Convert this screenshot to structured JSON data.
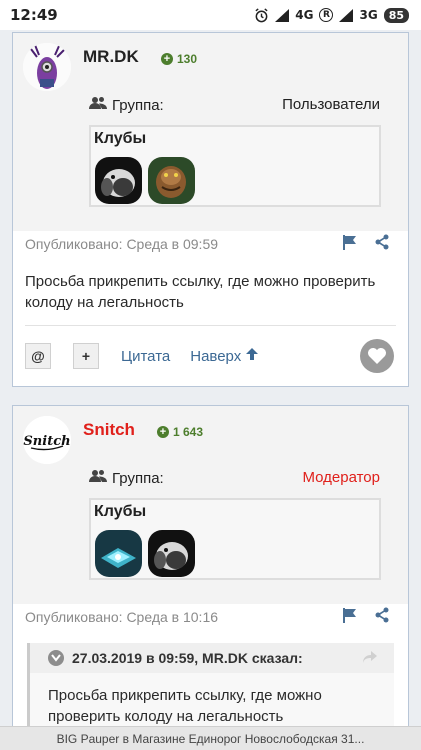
{
  "status_bar": {
    "time": "12:49",
    "network_1": "4G",
    "network_2": "3G",
    "registered_mark": "R",
    "battery": "85"
  },
  "posts": [
    {
      "author": "MR.DK",
      "reputation": "130",
      "group_label": "Группа:",
      "group_value": "Пользователи",
      "clubs_title": "Клубы",
      "published": "Опубликовано: Среда в 09:59",
      "text": "Просьба прикрепить ссылку, где можно проверить колоду на легальность",
      "actions": {
        "mention": "@",
        "add": "+",
        "quote": "Цитата",
        "top": "Наверх"
      }
    },
    {
      "author": "Snitch",
      "reputation": "1 643",
      "group_label": "Группа:",
      "group_value": "Модератор",
      "clubs_title": "Клубы",
      "published": "Опубликовано: Среда в 10:16",
      "quote": {
        "header": "27.03.2019 в 09:59, MR.DK сказал:",
        "text": "Просьба прикрепить ссылку, где можно проверить колоду на легальность"
      }
    }
  ],
  "bottom_banner": "BIG Pauper в Магазине Единорог Новослободская 31...",
  "colors": {
    "author_default": "#222222",
    "author_moderator": "#e0201b",
    "moderator_group": "#e0201b",
    "reputation": "#4d7e2d",
    "link": "#3c6994",
    "meta": "#8a8a8a"
  }
}
